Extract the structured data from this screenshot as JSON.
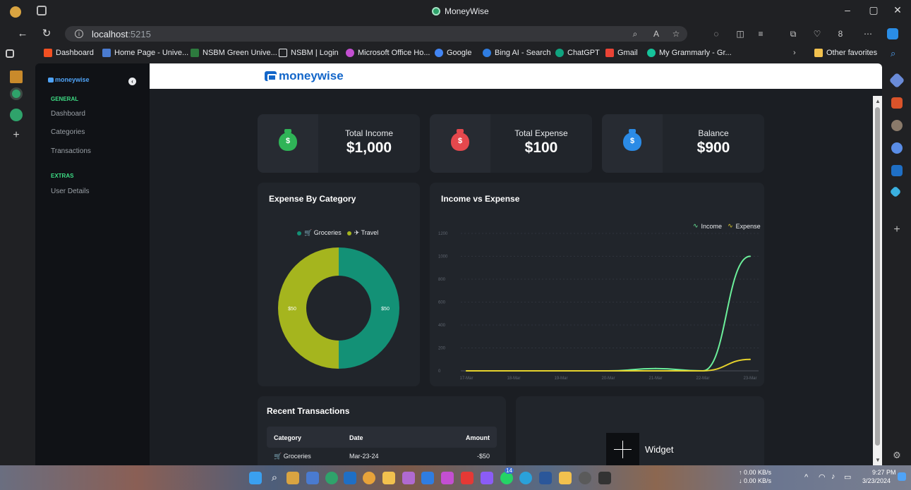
{
  "browser": {
    "window_title": "MoneyWise",
    "url_host": "localhost",
    "url_port": ":5215",
    "bookmarks": [
      {
        "label": "Dashboard",
        "color": "#f25022"
      },
      {
        "label": "Home Page - Unive...",
        "color": "#4a7bd0"
      },
      {
        "label": "NSBM Green Unive...",
        "color": "#2d7a3e"
      },
      {
        "label": "NSBM | Login",
        "color": "#e8eaed"
      },
      {
        "label": "Microsoft Office Ho...",
        "color": "#c34fd1"
      },
      {
        "label": "Google",
        "color": "#4285f4"
      },
      {
        "label": "Bing AI - Search",
        "color": "#2f7de1"
      },
      {
        "label": "ChatGPT",
        "color": "#10a37f"
      },
      {
        "label": "Gmail",
        "color": "#ea4335"
      },
      {
        "label": "My Grammarly - Gr...",
        "color": "#15c39a"
      }
    ],
    "other_favorites": "Other favorites"
  },
  "sidebar": {
    "logo": "moneywise",
    "sections": [
      {
        "title": "GENERAL",
        "items": [
          "Dashboard",
          "Categories",
          "Transactions"
        ]
      },
      {
        "title": "EXTRAS",
        "items": [
          "User Details"
        ]
      }
    ]
  },
  "header": {
    "brand": "moneywise"
  },
  "stats": [
    {
      "label": "Total Income",
      "value": "$1,000",
      "color": "#2fb457"
    },
    {
      "label": "Total Expense",
      "value": "$100",
      "color": "#e5484d"
    },
    {
      "label": "Balance",
      "value": "$900",
      "color": "#2b8be6"
    }
  ],
  "expense_chart": {
    "title": "Expense By Category",
    "legend": [
      "🛒 Groceries",
      "✈ Travel"
    ],
    "slice_labels": [
      "$50",
      "$50"
    ]
  },
  "income_chart": {
    "title": "Income vs Expense",
    "legend": [
      "Income",
      "Expense"
    ]
  },
  "chart_data": [
    {
      "type": "pie",
      "title": "Expense By Category",
      "categories": [
        "Groceries",
        "Travel"
      ],
      "values": [
        50,
        50
      ],
      "colors": [
        "#139176",
        "#a5b51e"
      ]
    },
    {
      "type": "line",
      "title": "Income vs Expense",
      "x": [
        "17-Mar",
        "18-Mar",
        "19-Mar",
        "20-Mar",
        "21-Mar",
        "22-Mar",
        "23-Mar"
      ],
      "yticks": [
        0,
        200,
        400,
        600,
        800,
        1000,
        1200
      ],
      "ylim": [
        0,
        1200
      ],
      "series": [
        {
          "name": "Income",
          "values": [
            0,
            0,
            0,
            0,
            20,
            0,
            1000
          ],
          "color": "#6cf09b"
        },
        {
          "name": "Expense",
          "values": [
            0,
            0,
            0,
            0,
            0,
            0,
            100
          ],
          "color": "#e6d22c"
        }
      ],
      "legend": "top-right",
      "grid": true
    }
  ],
  "transactions": {
    "title": "Recent Transactions",
    "columns": [
      "Category",
      "Date",
      "Amount"
    ],
    "rows": [
      {
        "category": "🛒 Groceries",
        "date": "Mar-23-24",
        "amount": "-$50"
      }
    ]
  },
  "widget": {
    "label": "Widget"
  },
  "taskbar": {
    "net_up": "↑ 0.00 KB/s",
    "net_down": "↓ 0.00 KB/s",
    "time": "9:27 PM",
    "date": "3/23/2024",
    "badge": "14"
  }
}
